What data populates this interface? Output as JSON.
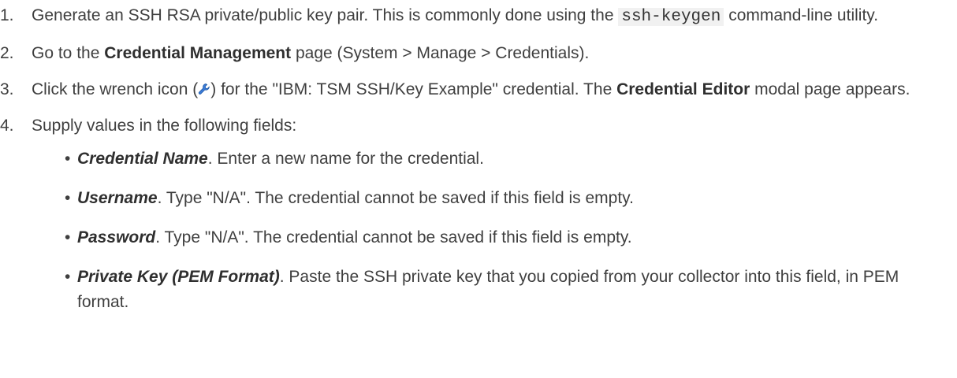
{
  "steps": [
    {
      "number": "1.",
      "text_before": "Generate an SSH RSA private/public key pair. This is commonly done using the ",
      "code": "ssh-keygen",
      "text_after": " command-line utility."
    },
    {
      "number": "2.",
      "text_before": "Go to the ",
      "bold": "Credential Management",
      "text_after": " page (System > Manage > Credentials)."
    },
    {
      "number": "3.",
      "text_before": "Click the wrench icon (",
      "icon": "wrench-icon",
      "text_middle": ") for the \"IBM: TSM SSH/Key Example\" credential. The ",
      "bold": "Credential Editor",
      "text_after": " modal page appears."
    },
    {
      "number": "4.",
      "text": "Supply values in the following fields:"
    }
  ],
  "fields": [
    {
      "bullet": "•",
      "name": "Credential Name",
      "description": ". Enter a new name for the credential."
    },
    {
      "bullet": "•",
      "name": "Username",
      "description": ". Type \"N/A\". The credential cannot be saved if this field is empty."
    },
    {
      "bullet": "•",
      "name": "Password",
      "description": ". Type \"N/A\". The credential cannot be saved if this field is empty."
    },
    {
      "bullet": "•",
      "name": "Private Key (PEM Format)",
      "description": ". Paste the SSH private key that you copied from your collector into this field, in PEM format."
    }
  ],
  "colors": {
    "text": "#3f3f3f",
    "code_background": "#f1f1f1",
    "wrench_icon": "#3b7bd8"
  }
}
